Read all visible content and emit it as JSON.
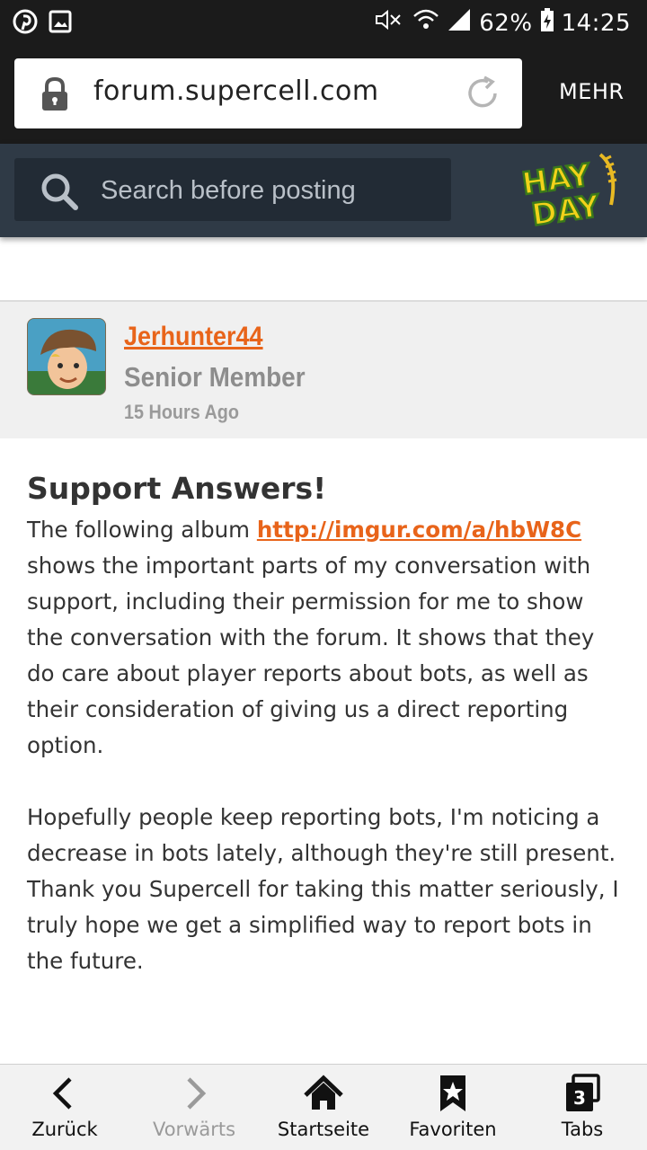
{
  "status_bar": {
    "battery": "62%",
    "time": "14:25",
    "left_icons": [
      "pinterest-icon",
      "image-icon"
    ],
    "right_icons": [
      "mute-icon",
      "wifi-icon",
      "signal-icon",
      "battery-charging-icon"
    ]
  },
  "browser": {
    "url": "forum.supercell.com",
    "menu_label": "MEHR"
  },
  "forum_header": {
    "search_placeholder": "Search before posting",
    "logo_text": "HAY DAY"
  },
  "post": {
    "username": "Jerhunter44",
    "rank": "Senior Member",
    "time": "15 Hours Ago",
    "title": "Support Answers!",
    "para1_before_link": "The following album ",
    "link": "http://imgur.com/a/hbW8C",
    "para1_after_link": " shows the important parts of my conversation with support, including their permission for me to show the conversation with the forum. It shows that they do care about player reports about bots, as well as their consideration of giving us a direct reporting option.",
    "para2": "Hopefully people keep reporting bots, I'm noticing a decrease in bots lately, although they're still present. Thank you Supercell for taking this matter seriously, I truly hope we get a simplified way to report bots in the future."
  },
  "bottom_nav": {
    "back": "Zurück",
    "forward": "Vorwärts",
    "home": "Startseite",
    "favorites": "Favoriten",
    "tabs": "Tabs",
    "tabs_count": "3"
  },
  "colors": {
    "accent": "#e8641a",
    "header": "#2f3a46",
    "statusbar": "#1b1b1b"
  }
}
